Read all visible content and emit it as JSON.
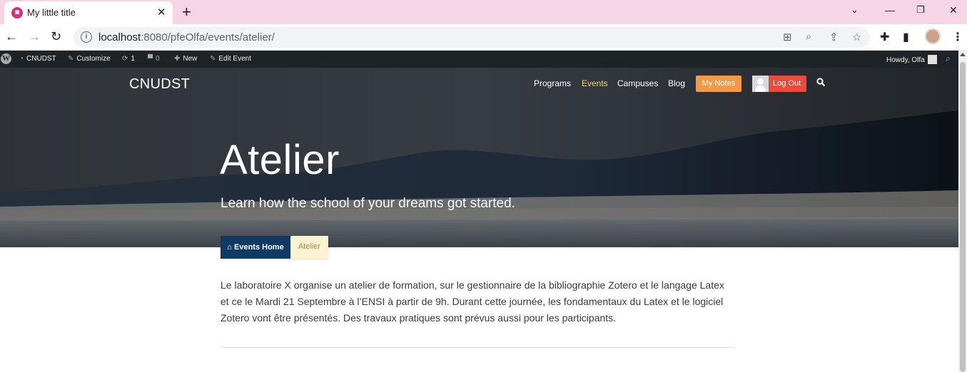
{
  "browser": {
    "tab_title": "My little title",
    "url_host": "localhost",
    "url_rest": ":8080/pfeOlfa/events/atelier/"
  },
  "admin_bar": {
    "site_name": "CNUDST",
    "customize": "Customize",
    "updates_count": "1",
    "comments_count": "0",
    "new_label": "New",
    "edit_label": "Edit Event",
    "howdy": "Howdy, Olfa"
  },
  "site": {
    "title": "CNUDST",
    "nav": [
      "Programs",
      "Events",
      "Campuses",
      "Blog"
    ],
    "active_nav": "Events",
    "my_notes": "My Notes",
    "log_out": "Log Out"
  },
  "hero": {
    "title": "Atelier",
    "subtitle": "Learn how the school of your dreams got started."
  },
  "breadcrumb": {
    "home_label": "Events Home",
    "current": "Atelier"
  },
  "content": {
    "body": "Le laboratoire X organise un atelier de formation, sur le gestionnaire de la bibliographie Zotero et le langage Latex et ce le Mardi 21 Septembre à l’ENSI à partir de 9h. Durant cette journée, les fondamentaux du Latex et le logiciel Zotero vont être présentés. Des travaux pratiques sont prévus aussi pour les participants."
  },
  "colors": {
    "tabbar_bg": "#f6d6e6",
    "admin_bar_bg": "#1d2327",
    "active_nav": "#f5d57b",
    "my_notes_bg": "#f2994a",
    "log_out_bg": "#e84c3d",
    "crumb_home_bg": "#0f3a63",
    "crumb_current_bg": "#fdf3d0"
  },
  "icons": {
    "favicon": "app-favicon-icon",
    "home": "home-icon",
    "search": "search-icon"
  }
}
